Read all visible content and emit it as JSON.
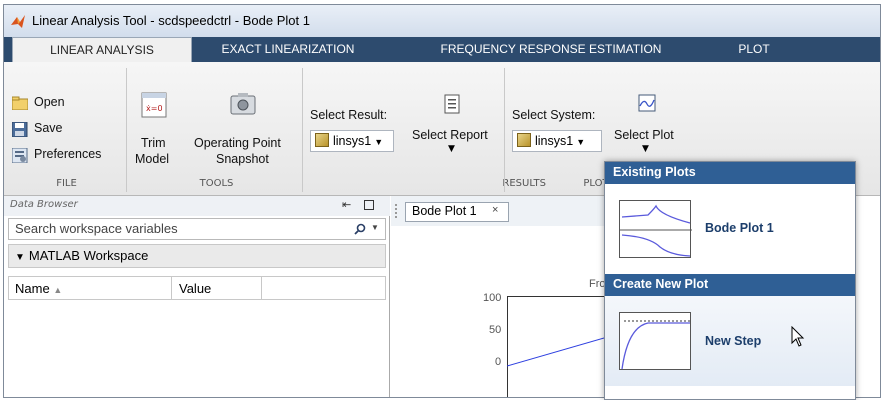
{
  "window": {
    "title": "Linear Analysis Tool - scdspeedctrl - Bode Plot 1"
  },
  "tabs": [
    "LINEAR ANALYSIS",
    "EXACT LINEARIZATION",
    "FREQUENCY RESPONSE ESTIMATION",
    "PLOT"
  ],
  "file_group": {
    "open": "Open",
    "save": "Save",
    "preferences": "Preferences",
    "label": "FILE"
  },
  "tools_group": {
    "trim_model_1": "Trim",
    "trim_model_2": "Model",
    "op_snapshot_1": "Operating Point",
    "op_snapshot_2": "Snapshot",
    "label": "TOOLS"
  },
  "results_group": {
    "select_result": "Select Result:",
    "result_value": "linsys1",
    "select_report": "Select Report",
    "label": "RESULTS"
  },
  "plot_group": {
    "select_system": "Select System:",
    "system_value": "linsys1",
    "select_plot": "Select Plot",
    "label": "PLOT"
  },
  "data_browser": {
    "title": "Data Browser",
    "search_placeholder": "Search workspace variables",
    "workspace": "MATLAB Workspace",
    "col_name": "Name",
    "col_value": "Value"
  },
  "plot_doc": {
    "tab_label": "Bode Plot 1",
    "from_label": "Fro",
    "yticks": [
      "100",
      "50",
      "0"
    ]
  },
  "dropdown": {
    "existing_header": "Existing Plots",
    "existing_item": "Bode Plot 1",
    "create_header": "Create New Plot",
    "new_item": "New Step"
  }
}
